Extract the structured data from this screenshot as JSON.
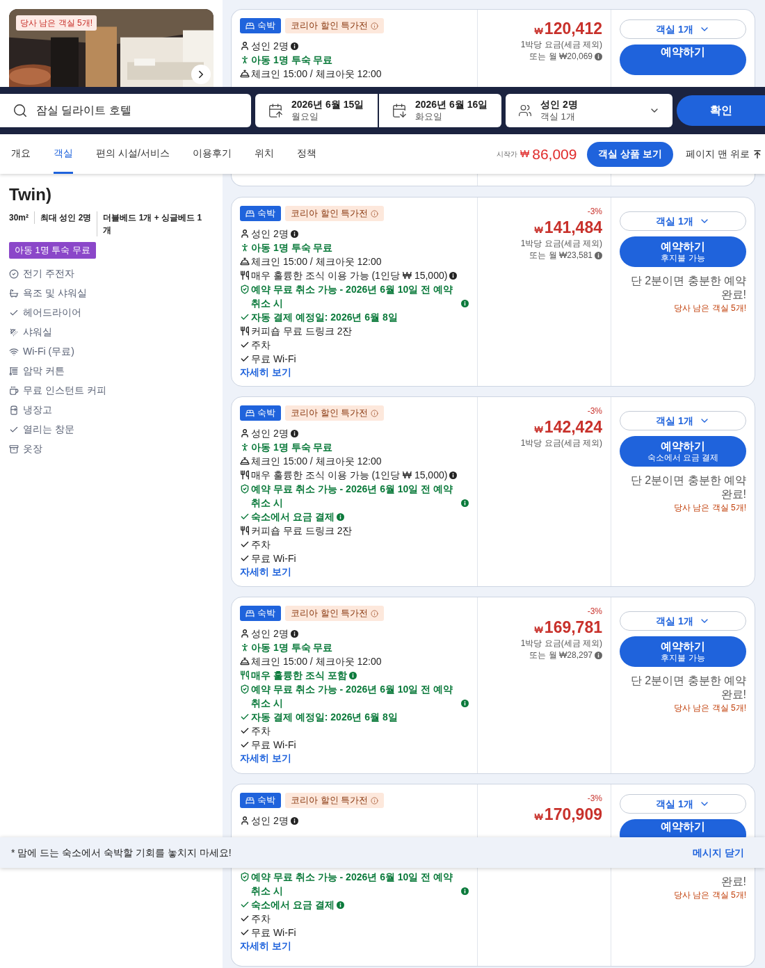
{
  "top_listing": {
    "photo_badge": "당사 남은 객실 5개!",
    "offer": {
      "tags": [
        {
          "kind": "stay",
          "label": "숙박"
        },
        {
          "kind": "promo",
          "label": "코리아 할인 특가전"
        }
      ],
      "features": [
        {
          "kind": "person",
          "text": "성인 2명",
          "highlighted": false,
          "info": true
        },
        {
          "kind": "child",
          "text": "아동 1명 투숙 무료",
          "highlighted": true,
          "info": false
        },
        {
          "kind": "checkin",
          "text": "체크인 15:00 / 체크아웃 12:00",
          "highlighted": false,
          "info": false
        }
      ],
      "price": "120,412",
      "currency": "₩",
      "price_note": "1박당 요금(세금 제외)",
      "monthly": "또는 월 ₩20,069",
      "room_select": "객실 1개",
      "book": {
        "label": "예약하기"
      }
    }
  },
  "search_bar": {
    "query": "잠실 딜라이트 호텔",
    "dates": [
      {
        "date": "2026년 6월 15일",
        "weekday": "월요일",
        "kind": "in"
      },
      {
        "date": "2026년 6월 16일",
        "weekday": "화요일",
        "kind": "out"
      }
    ],
    "guests": {
      "main": "성인 2명",
      "sub": "객실 1개"
    },
    "submit": "확인"
  },
  "nav": {
    "tabs": [
      {
        "label": "개요",
        "selected": false
      },
      {
        "label": "객실",
        "selected": true
      },
      {
        "label": "편의 시설/서비스",
        "selected": false
      },
      {
        "label": "이용후기",
        "selected": false
      },
      {
        "label": "위치",
        "selected": false
      },
      {
        "label": "정책",
        "selected": false
      }
    ],
    "from_label": "시작가",
    "from_currency": "₩",
    "from_price": "86,009",
    "rooms_button": "객실 상품 보기",
    "to_top": "페이지 맨 위로"
  },
  "room": {
    "title": "Twin)",
    "specs": [
      "30m²",
      "최대 성인 2명",
      "더블베드 1개 + 싱글베드 1개"
    ],
    "badge": "아동 1명 투숙 무료",
    "amenities": [
      {
        "kind": "check-circle",
        "label": "전기 주전자"
      },
      {
        "kind": "bath",
        "label": "욕조 및 샤워실"
      },
      {
        "kind": "check",
        "label": "헤어드라이어"
      },
      {
        "kind": "shower",
        "label": "샤워실"
      },
      {
        "kind": "wifi",
        "label": "Wi-Fi (무료)"
      },
      {
        "kind": "blinds",
        "label": "암막 커튼"
      },
      {
        "kind": "coffee",
        "label": "무료 인스턴트 커피"
      },
      {
        "kind": "fridge",
        "label": "냉장고"
      },
      {
        "kind": "check",
        "label": "열리는 창문"
      },
      {
        "kind": "closet",
        "label": "옷장"
      }
    ]
  },
  "offers": [
    {
      "tags": [
        {
          "kind": "stay",
          "label": "숙박"
        },
        {
          "kind": "promo",
          "label": "코리아 할인 특가전"
        }
      ],
      "features": [
        {
          "kind": "person",
          "text": "성인 2명",
          "highlighted": false,
          "info": true
        },
        {
          "kind": "child",
          "text": "아동 1명 투숙 무료",
          "highlighted": true,
          "info": false
        },
        {
          "kind": "checkin",
          "text": "체크인 15:00 / 체크아웃 12:00",
          "highlighted": false,
          "info": false
        },
        {
          "kind": "dining",
          "text": "매우 훌륭한 조식 이용 가능 (1인당 ₩ 15,000)",
          "highlighted": false,
          "info": true
        },
        {
          "kind": "shield",
          "text": "예약 무료 취소 가능 - 2026년 6월 10일 전 예약 취소 시",
          "highlighted": true,
          "info": true
        },
        {
          "kind": "check",
          "text": "자동 결제 예정일: 2026년 6월 8일",
          "highlighted": true,
          "info": false
        },
        {
          "kind": "dining",
          "text": "커피숍 무료 드링크 2잔",
          "highlighted": false,
          "info": false
        },
        {
          "kind": "check",
          "text": "주차",
          "highlighted": false,
          "info": false
        },
        {
          "kind": "check",
          "text": "무료 Wi-Fi",
          "highlighted": false,
          "info": false
        }
      ],
      "details": "자세히 보기",
      "discount": "-3%",
      "currency": "₩",
      "price": "141,484",
      "price_note": "1박당 요금(세금 제외)",
      "monthly": "또는 월 ₩23,581",
      "room_select": "객실 1개",
      "book": {
        "label": "예약하기",
        "sub": "후지불 가능"
      },
      "note": "단 2분이면 충분한 예약 완료!",
      "urgency": "당사 남은 객실 5개!"
    },
    {
      "tags": [
        {
          "kind": "stay",
          "label": "숙박"
        },
        {
          "kind": "promo",
          "label": "코리아 할인 특가전"
        }
      ],
      "features": [
        {
          "kind": "person",
          "text": "성인 2명",
          "highlighted": false,
          "info": true
        },
        {
          "kind": "child",
          "text": "아동 1명 투숙 무료",
          "highlighted": true,
          "info": false
        },
        {
          "kind": "checkin",
          "text": "체크인 15:00 / 체크아웃 12:00",
          "highlighted": false,
          "info": false
        },
        {
          "kind": "dining",
          "text": "매우 훌륭한 조식 이용 가능 (1인당 ₩ 15,000)",
          "highlighted": false,
          "info": true
        },
        {
          "kind": "shield",
          "text": "예약 무료 취소 가능 - 2026년 6월 10일 전 예약 취소 시",
          "highlighted": true,
          "info": true
        },
        {
          "kind": "check",
          "text": "숙소에서 요금 결제",
          "highlighted": true,
          "info": true
        },
        {
          "kind": "dining",
          "text": "커피숍 무료 드링크 2잔",
          "highlighted": false,
          "info": false
        },
        {
          "kind": "check",
          "text": "주차",
          "highlighted": false,
          "info": false
        },
        {
          "kind": "check",
          "text": "무료 Wi-Fi",
          "highlighted": false,
          "info": false
        }
      ],
      "details": "자세히 보기",
      "discount": "-3%",
      "currency": "₩",
      "price": "142,424",
      "price_note": "1박당 요금(세금 제외)",
      "room_select": "객실 1개",
      "book": {
        "label": "예약하기",
        "sub": "숙소에서 요금 결제"
      },
      "note": "단 2분이면 충분한 예약 완료!",
      "urgency": "당사 남은 객실 5개!"
    },
    {
      "tags": [
        {
          "kind": "stay",
          "label": "숙박"
        },
        {
          "kind": "promo",
          "label": "코리아 할인 특가전"
        }
      ],
      "features": [
        {
          "kind": "person",
          "text": "성인 2명",
          "highlighted": false,
          "info": true
        },
        {
          "kind": "child",
          "text": "아동 1명 투숙 무료",
          "highlighted": true,
          "info": false
        },
        {
          "kind": "checkin",
          "text": "체크인 15:00 / 체크아웃 12:00",
          "highlighted": false,
          "info": false
        },
        {
          "kind": "dining",
          "text": "매우 훌륭한 조식 포함",
          "highlighted": true,
          "info": true
        },
        {
          "kind": "shield",
          "text": "예약 무료 취소 가능 - 2026년 6월 10일 전 예약 취소 시",
          "highlighted": true,
          "info": true
        },
        {
          "kind": "check",
          "text": "자동 결제 예정일: 2026년 6월 8일",
          "highlighted": true,
          "info": false
        },
        {
          "kind": "check",
          "text": "주차",
          "highlighted": false,
          "info": false
        },
        {
          "kind": "check",
          "text": "무료 Wi-Fi",
          "highlighted": false,
          "info": false
        }
      ],
      "details": "자세히 보기",
      "discount": "-3%",
      "currency": "₩",
      "price": "169,781",
      "price_note": "1박당 요금(세금 제외)",
      "monthly": "또는 월 ₩28,297",
      "room_select": "객실 1개",
      "book": {
        "label": "예약하기",
        "sub": "후지불 가능"
      },
      "note": "단 2분이면 충분한 예약 완료!",
      "urgency": "당사 남은 객실 5개!"
    }
  ],
  "last_offer_top": {
    "tags": [
      {
        "kind": "stay",
        "label": "숙박"
      },
      {
        "kind": "promo",
        "label": "코리아 할인 특가전"
      }
    ],
    "features": [
      {
        "kind": "person",
        "text": "성인 2명",
        "highlighted": false,
        "info": true
      }
    ],
    "discount": "-3%",
    "currency": "₩",
    "price": "170,909",
    "room_select": "객실 1개",
    "book": {
      "label": "예약하기"
    }
  },
  "banner": {
    "message": "* 맘에 드는 숙소에서 숙박할 기회를 놓치지 마세요!",
    "close": "메시지 닫기"
  },
  "last_offer_bottom": {
    "features": [
      {
        "kind": "shield",
        "text": "예약 무료 취소 가능 - 2026년 6월 10일 전 예약 취소 시",
        "highlighted": true,
        "info": true
      },
      {
        "kind": "check",
        "text": "숙소에서 요금 결제",
        "highlighted": true,
        "info": true
      },
      {
        "kind": "check",
        "text": "주차",
        "highlighted": false,
        "info": false
      },
      {
        "kind": "check",
        "text": "무료 Wi-Fi",
        "highlighted": false,
        "info": false
      }
    ],
    "details": "자세히 보기",
    "note": "완료!",
    "urgency": "당사 남은 객실 5개!"
  }
}
